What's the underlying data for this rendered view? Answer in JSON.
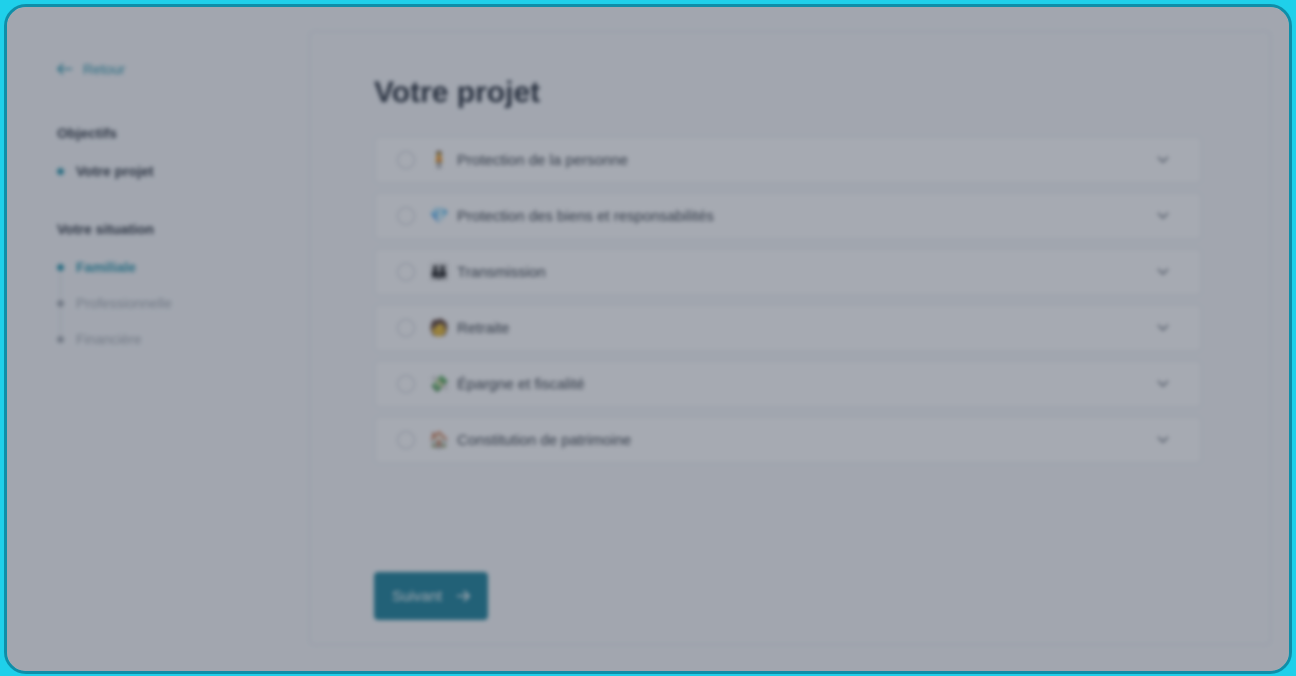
{
  "sidebar": {
    "back_label": "Retour",
    "sections": [
      {
        "title": "Objectifs",
        "items": [
          {
            "label": "Votre projet",
            "state": "active"
          }
        ]
      },
      {
        "title": "Votre situation",
        "items": [
          {
            "label": "Familiale",
            "state": "current"
          },
          {
            "label": "Professionnelle",
            "state": "inactive"
          },
          {
            "label": "Financière",
            "state": "inactive"
          }
        ]
      }
    ]
  },
  "main": {
    "title": "Votre projet",
    "options": [
      {
        "emoji": "🧍",
        "label": "Protection de la personne"
      },
      {
        "emoji": "💎",
        "label": "Protection des biens et responsabilités"
      },
      {
        "emoji": "👪",
        "label": "Transmission"
      },
      {
        "emoji": "🧑",
        "label": "Retraite"
      },
      {
        "emoji": "💸",
        "label": "Épargne et fiscalité"
      },
      {
        "emoji": "🏠",
        "label": "Constitution de patrimoine"
      }
    ],
    "next_button": {
      "label": "Suivant",
      "icon": "arrow-right-icon"
    }
  },
  "colors": {
    "accent": "#1b8fa7",
    "button": "#0f7a94",
    "frame_border": "#0f8ea8",
    "outer_bg": "#1fd0ea",
    "overlay": "#3a4254"
  }
}
